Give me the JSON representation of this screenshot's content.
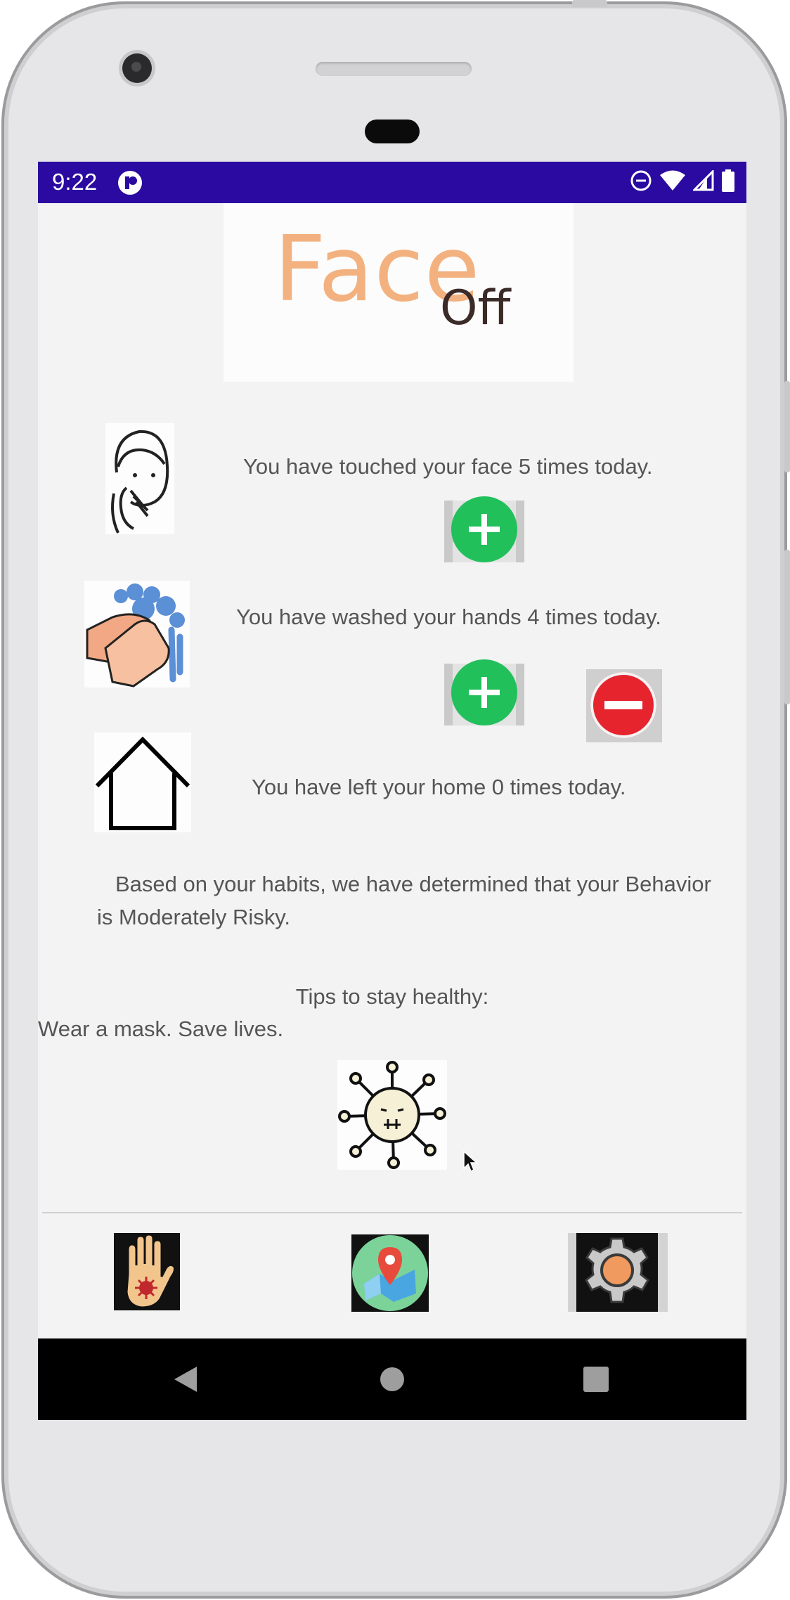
{
  "status_bar": {
    "time": "9:22",
    "background": "#2a0aa0"
  },
  "header": {
    "logo_main": "Face",
    "logo_sub": "Off"
  },
  "counters": {
    "face_touch_text": "You have touched your face 5 times today.",
    "hand_wash_text": "You have washed your hands 4 times today.",
    "left_home_text": "You have left your home 0 times today."
  },
  "summary": {
    "text": "Based on your habits, we have determined that your Behavior is Moderately Risky."
  },
  "tips": {
    "title": "Tips to stay healthy:",
    "body": "Wear a mask. Save lives."
  },
  "icons": {
    "face_touch": "face-touch-icon",
    "hand_wash": "hand-wash-icon",
    "home": "home-icon",
    "virus": "virus-icon",
    "add": "plus-icon",
    "remove": "minus-icon",
    "nav_hand": "hand-virus-icon",
    "nav_map": "map-icon",
    "nav_settings": "gear-icon"
  },
  "colors": {
    "accent_green": "#21c05b",
    "accent_red": "#e6242e"
  }
}
